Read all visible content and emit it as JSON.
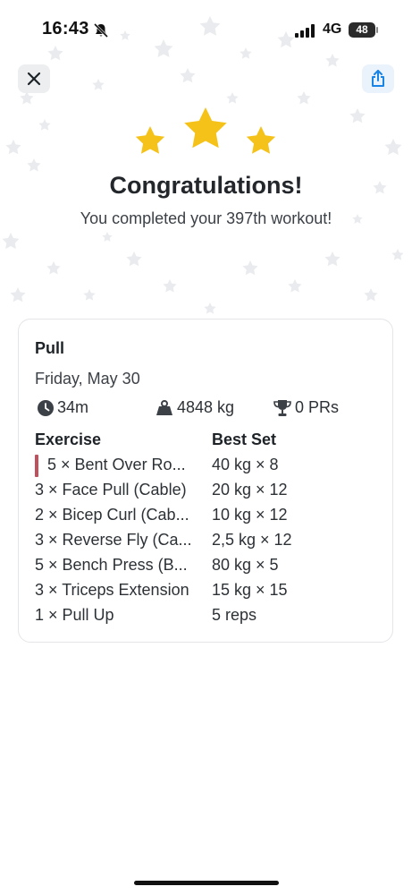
{
  "status_bar": {
    "time": "16:43",
    "network": "4G",
    "battery": "48"
  },
  "header": {
    "close_icon": "close-icon",
    "share_icon": "share-icon",
    "accent_color": "#1a84e6"
  },
  "celebration": {
    "star_color": "#f5c21a",
    "title": "Congratulations!",
    "subtitle": "You completed your 397th workout!"
  },
  "workout": {
    "name": "Pull",
    "date": "Friday, May 30",
    "duration": "34m",
    "volume": "4848 kg",
    "prs": "0 PRs",
    "columns": {
      "exercise": "Exercise",
      "best_set": "Best Set"
    },
    "exercises": [
      {
        "name": "5 × Bent Over Ro...",
        "best_set": "40 kg × 8",
        "marker_color": "#c0505c"
      },
      {
        "name": "3 × Face Pull (Cable)",
        "best_set": "20 kg × 12"
      },
      {
        "name": "2 × Bicep Curl (Cab...",
        "best_set": "10 kg × 12"
      },
      {
        "name": "3 × Reverse Fly (Ca...",
        "best_set": "2,5 kg × 12"
      },
      {
        "name": "5 × Bench Press (B...",
        "best_set": "80 kg × 5"
      },
      {
        "name": "3 × Triceps Extension",
        "best_set": "15 kg × 15"
      },
      {
        "name": "1 × Pull Up",
        "best_set": "5 reps"
      }
    ]
  }
}
